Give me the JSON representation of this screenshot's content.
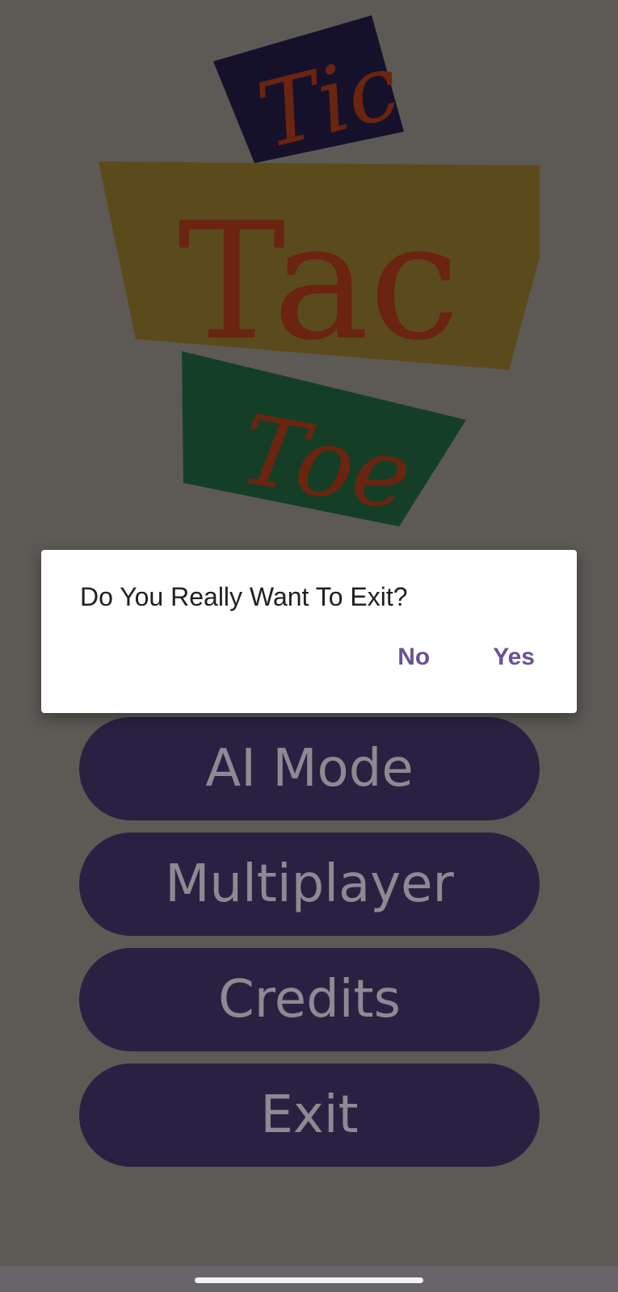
{
  "logo": {
    "word_1": "Tic",
    "word_2": "Tac",
    "word_3": "Toe",
    "colors": {
      "tic_box": "#15112b",
      "tac_box": "#5b4a1b",
      "toe_box": "#143f26",
      "lettering": "#6a2410"
    }
  },
  "menu": {
    "ai_mode": "AI Mode",
    "multiplayer": "Multiplayer",
    "credits": "Credits",
    "exit": "Exit"
  },
  "dialog": {
    "message": "Do You Really Want To Exit?",
    "no_label": "No",
    "yes_label": "Yes",
    "accent_color": "#6a5198"
  },
  "colors": {
    "scrim_background": "#5d5955",
    "button_fill": "#2a2142",
    "button_text": "#8c8a92"
  }
}
